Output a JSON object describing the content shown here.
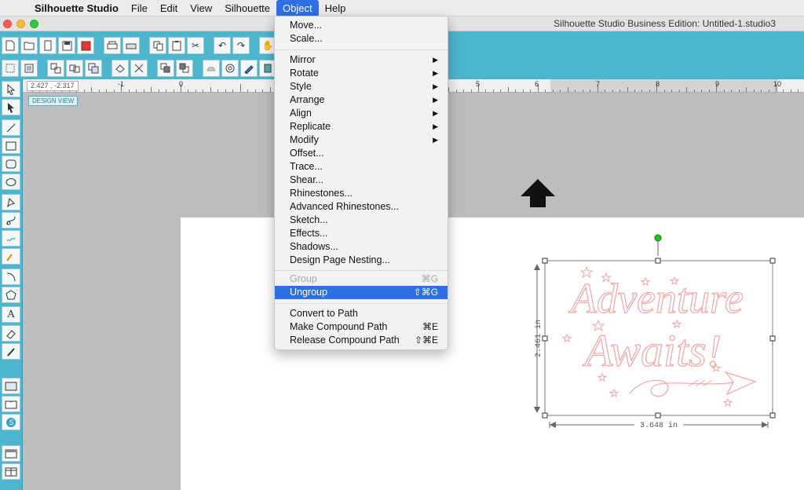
{
  "menubar": {
    "apple_glyph": "",
    "items": [
      "Silhouette Studio",
      "File",
      "Edit",
      "View",
      "Silhouette",
      "Object",
      "Help"
    ],
    "active": "Object"
  },
  "window": {
    "title": "Silhouette Studio Business Edition: Untitled-1.studio3"
  },
  "ruler": {
    "coords": "2.427 , -2.317",
    "numbers": [
      "-1",
      "0",
      "5",
      "6",
      "7",
      "8",
      "9",
      "10"
    ]
  },
  "canvas": {
    "view_label": "DESIGN VIEW",
    "design_title_line1": "Adventure",
    "design_title_line2": "Awaits!",
    "height_label": "2.461 in",
    "width_label": "3.648 in"
  },
  "object_menu": {
    "group1": [
      "Move...",
      "Scale..."
    ],
    "group2": [
      {
        "label": "Mirror",
        "submenu": true
      },
      {
        "label": "Rotate",
        "submenu": true
      },
      {
        "label": "Style",
        "submenu": true
      },
      {
        "label": "Arrange",
        "submenu": true
      },
      {
        "label": "Align",
        "submenu": true
      },
      {
        "label": "Replicate",
        "submenu": true
      },
      {
        "label": "Modify",
        "submenu": true
      },
      {
        "label": "Offset...",
        "submenu": false
      },
      {
        "label": "Trace...",
        "submenu": false
      },
      {
        "label": "Shear...",
        "submenu": false
      },
      {
        "label": "Rhinestones...",
        "submenu": false
      },
      {
        "label": "Advanced Rhinestones...",
        "submenu": false
      },
      {
        "label": "Sketch...",
        "submenu": false
      },
      {
        "label": "Effects...",
        "submenu": false
      },
      {
        "label": "Shadows...",
        "submenu": false
      },
      {
        "label": "Design Page Nesting...",
        "submenu": false
      }
    ],
    "group3": [
      {
        "label": "Group",
        "shortcut": "⌘G",
        "disabled": true
      },
      {
        "label": "Ungroup",
        "shortcut": "⇧⌘G",
        "highlighted": true
      }
    ],
    "group4": [
      {
        "label": "Convert to Path",
        "shortcut": ""
      },
      {
        "label": "Make Compound Path",
        "shortcut": "⌘E"
      },
      {
        "label": "Release Compound Path",
        "shortcut": "⇧⌘E"
      }
    ],
    "submenu_arrow": "▶"
  },
  "colors": {
    "accent_teal": "#4db6ce",
    "menu_highlight": "#2f6fe5",
    "design_stroke": "#f1a6a6",
    "handle_green": "#22c322"
  },
  "icons": {
    "toolbar_row1": [
      "new-doc-icon",
      "open-folder-icon",
      "open-sd-icon",
      "save-icon",
      "save-library-icon",
      "print-icon",
      "print-cut-icon",
      "copy-icon",
      "paste-icon",
      "cut-icon",
      "undo-icon",
      "redo-icon",
      "pan-hand-icon",
      "zoom-in-icon",
      "zoom-out-icon"
    ],
    "toolbar_row2": [
      "registration-marks-icon",
      "group-icon",
      "ungroup-icon",
      "compound-path-icon",
      "release-compound-icon",
      "replicate-icon",
      "knife-icon",
      "bring-front-icon",
      "send-back-icon",
      "shape-tool-icon",
      "point-edit-icon",
      "pen-tool-icon",
      "library-icon"
    ],
    "left_tools": [
      "select-arrow-icon",
      "point-edit-icon",
      "line-tool-icon",
      "rectangle-tool-icon",
      "rounded-rect-tool-icon",
      "ellipse-tool-icon",
      "polygon-tool-icon",
      "curve-tool-icon",
      "freehand-tool-icon",
      "smooth-freehand-tool-icon",
      "arc-tool-icon",
      "regular-polygon-tool-icon",
      "text-tool-icon",
      "eraser-tool-icon",
      "knife-tool-icon",
      "page-setup-icon",
      "library-book-icon",
      "silhouette-store-icon",
      "panel-toggle-icon",
      "split-view-icon"
    ]
  }
}
